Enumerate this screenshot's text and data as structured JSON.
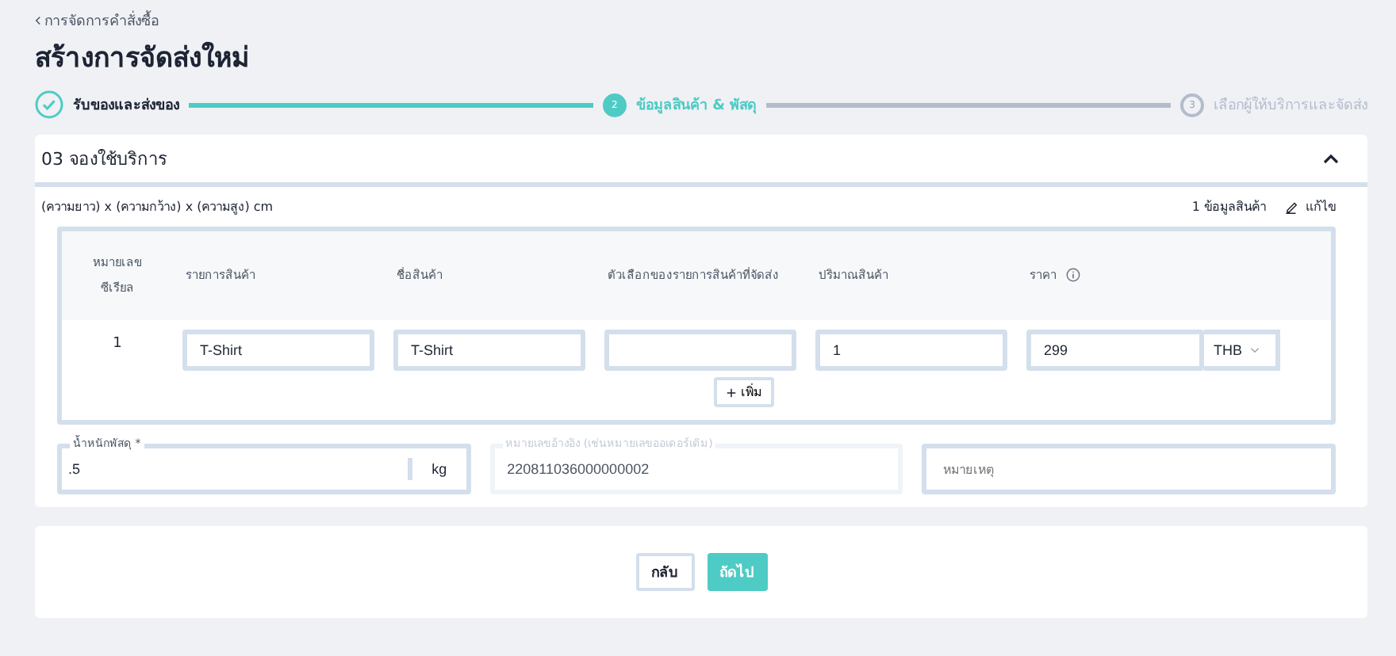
{
  "breadcrumb": "การจัดการคำสั่งซื้อ",
  "title": "สร้างการจัดส่งใหม่",
  "steps": [
    {
      "label": "รับของและส่งของ",
      "done": true,
      "selected": false
    },
    {
      "number": "2",
      "label": "ข้อมูลสินค้า & พัสดุ",
      "done": false,
      "selected": true
    },
    {
      "number": "3",
      "label": "เลือกผู้ให้บริการและจัดส่ง",
      "done": false,
      "selected": false
    }
  ],
  "section": {
    "title": "03 จองใช้บริการ",
    "expanded": true,
    "dimensions_note": "(ความยาว) x (ความกว้าง) x (ความสูง) cm",
    "item_count": "1 ข้อมูลสินค้า",
    "edit_link": "แก้ไข"
  },
  "table": {
    "columns": [
      "หมายเลขซีเรียล",
      "รายการสินค้า",
      "ชื่อสินค้า",
      "ตัวเลือกของรายการสินค้าที่จัดส่ง",
      "ปริมาณสินค้า",
      "ราคา"
    ],
    "rows": [
      {
        "serial": "1",
        "item": "T-Shirt",
        "name": "T-Shirt",
        "option": "",
        "quantity": "1",
        "price": "299",
        "currency": "THB"
      }
    ],
    "add_button": "เพิ่ม"
  },
  "weight": {
    "label": "น้ำหนักพัสดุ *",
    "value": ".5",
    "unit": "kg"
  },
  "reference": {
    "label": "หมายเลขอ้างอิง (เช่นหมายเลขออเดอร์เดิม)",
    "value": "220811036000000002",
    "disabled": true
  },
  "note": {
    "placeholder": "หมายเหตุ"
  },
  "buttons": {
    "back": "กลับ",
    "next": "ถัดไป"
  }
}
